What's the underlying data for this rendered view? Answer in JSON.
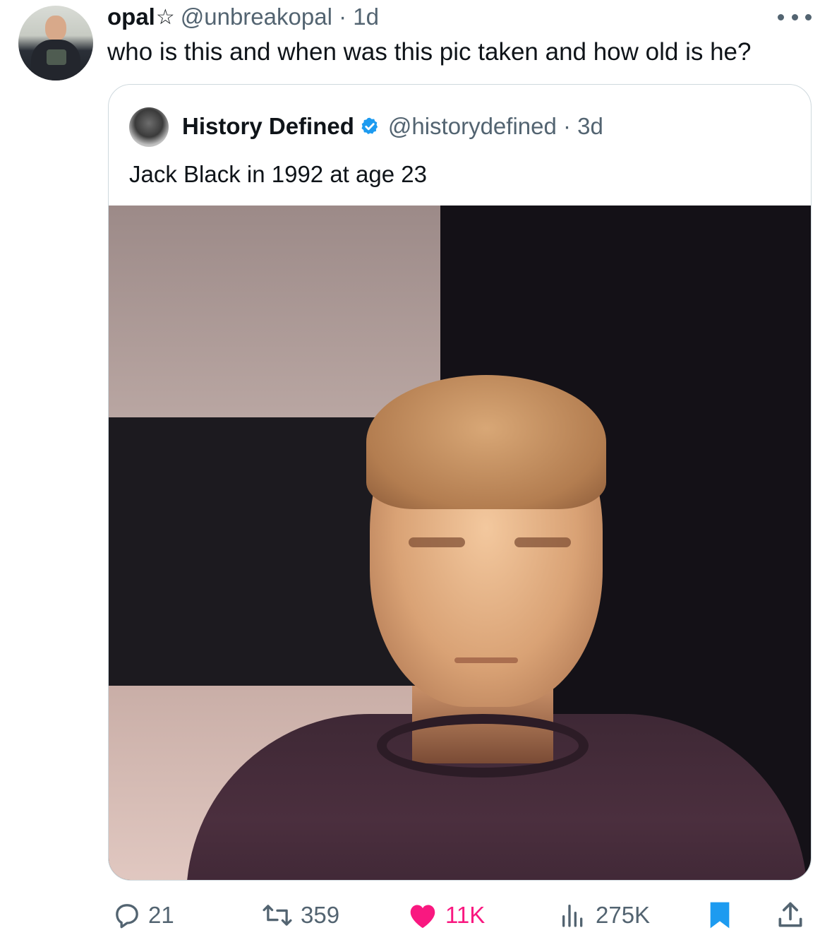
{
  "tweet": {
    "author": {
      "name": "opal",
      "name_suffix": "☆",
      "handle": "@unbreakopal · 1d"
    },
    "text": "who is this and when was this pic taken and how old is he?",
    "more_icon": "more-icon"
  },
  "quote": {
    "author": {
      "name": "History Defined",
      "handle": "@historydefined · 3d",
      "verified_icon": "verified-icon"
    },
    "text": "Jack Black in 1992 at age 23"
  },
  "actions": {
    "replies": "21",
    "reposts": "359",
    "likes": "11K",
    "views": "275K"
  },
  "colors": {
    "text": "#0f1419",
    "secondary": "#536471",
    "like": "#f91880",
    "accent": "#1d9bf0",
    "border": "#cfd9de"
  }
}
